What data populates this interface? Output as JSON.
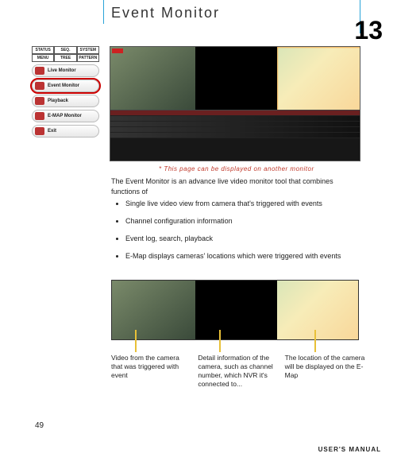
{
  "title": "Event Monitor",
  "chapter": "13",
  "note": "* This page can be displayed on another monitor",
  "intro": "The Event Monitor is an advance live video monitor tool that combines functions of",
  "bullets": [
    "Single live video view from camera that's triggered with events",
    "Channel configuration information",
    "Event log, search, playback",
    "E-Map displays cameras' locations which were triggered with events"
  ],
  "captions": {
    "video": "Video from the camera that was triggered with event",
    "info": "Detail information of the camera, such as channel number, which NVR it's connected to...",
    "map": "The location of the camera will be displayed on the E-Map"
  },
  "sidebar": {
    "tabs1": [
      "STATUS",
      "SEQ.",
      "SYSTEM"
    ],
    "tabs2": [
      "MENU",
      "TREE",
      "PATTERN"
    ],
    "items": [
      "Live Monitor",
      "Event Monitor",
      "Playback",
      "E-MAP Monitor",
      "Exit"
    ]
  },
  "page": "49",
  "footer": "USER'S MANUAL"
}
